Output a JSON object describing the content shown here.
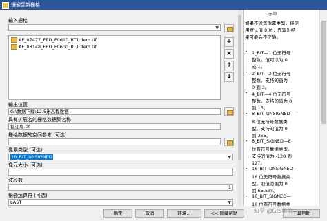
{
  "window": {
    "title": "镶嵌至新栅格"
  },
  "form": {
    "input_label": "输入栅格",
    "input_items": [
      "AF_07477_FBD_F0610_RT1.dem.tif",
      "AF_08148_FBD_F0600_RT1.dem.tif"
    ],
    "output_location_label": "输出位置",
    "output_location_value": "G:\\数据下载\\12.5米高程数据",
    "dataset_name_label": "具有扩展名的栅格数据集名称",
    "dataset_name_value": "都江堰.tif",
    "spatial_ref_label": "栅格数据的空间参考 (可选)",
    "pixel_type_label": "像素类型 (可选)",
    "pixel_type_value": "16_BIT_UNSIGNED",
    "cell_size_label": "像元大小 (可选)",
    "bands_label": "波段数",
    "bands_value": "1",
    "mosaic_operator_label": "镶嵌运算符 (可选)",
    "mosaic_operator_value": "LAST"
  },
  "buttons": {
    "ok": "确定",
    "cancel": "取消",
    "env": "环境...",
    "hide_help": "<< 隐藏帮助",
    "tool_help": "工具帮助"
  },
  "help": {
    "header": "示章",
    "intro": [
      "如果不设置像素类型，将使",
      "用默认值 8 位，而输出结",
      "果可能会不正确。"
    ],
    "bullets": [
      [
        "1_BIT—1 位无符号",
        "整数。值可以为 0",
        "或 1。"
      ],
      [
        "2_BIT—2 位无符号",
        "整数。支持的值为",
        "0 到 3。"
      ],
      [
        "4_BIT—4 位无符号",
        "整数。支持的值为 0",
        "到 15。"
      ],
      [
        "8_BIT_UNSIGNED—",
        "8 位无符号数据类",
        "型。支持的值为 0",
        "到 255。"
      ],
      [
        "8_BIT_SIGNED—8",
        "位有符号数据类型。",
        "支持的值为 -128 到",
        "127。"
      ],
      [
        "16_BIT_UNSIGNED—",
        "16 位无符号数据类",
        "型。取值范围为 0",
        "到 65,535。"
      ],
      [
        "16_BIT_SIGNED—",
        "16 位有符号数据类"
      ]
    ]
  },
  "watermark": "知乎 @GIS萌萌"
}
